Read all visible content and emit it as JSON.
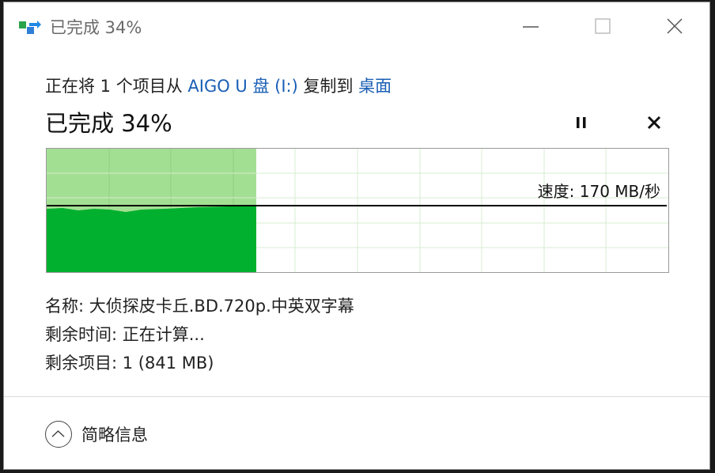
{
  "window": {
    "title": "已完成 34%",
    "controls": {
      "minimize_icon": "minimize-icon",
      "maximize_icon": "maximize-icon",
      "close_icon": "close-icon"
    }
  },
  "copy": {
    "prefix": "正在将 1 个项目从 ",
    "source": "AIGO U 盘 (I:)",
    "middle": " 复制到 ",
    "destination": "桌面",
    "progress_title": "已完成 34%",
    "progress_fraction": 0.34
  },
  "graph": {
    "speed_label": "速度: 170 MB/秒",
    "fill_color": "#00b02e",
    "completed_area_color": "#a3df93",
    "line_color": "#000000"
  },
  "details": {
    "name": "名称: 大侦探皮卡丘.BD.720p.中英双字幕",
    "time_remaining": "剩余时间: 正在计算...",
    "items_remaining": "剩余项目: 1 (841 MB)"
  },
  "footer": {
    "toggle_label": "简略信息",
    "toggle_icon": "chevron-up-icon"
  }
}
